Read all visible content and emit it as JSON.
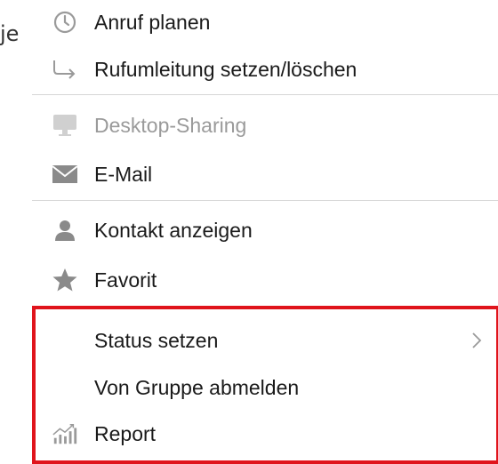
{
  "background": {
    "partial_text": "je"
  },
  "menu": {
    "items": [
      {
        "label": "Anruf planen",
        "icon": "clock-icon",
        "disabled": false
      },
      {
        "label": "Rufumleitung setzen/löschen",
        "icon": "forward-arrow-icon",
        "disabled": false
      },
      {
        "label": "Desktop-Sharing",
        "icon": "monitor-icon",
        "disabled": true
      },
      {
        "label": "E-Mail",
        "icon": "envelope-icon",
        "disabled": false
      },
      {
        "label": "Kontakt anzeigen",
        "icon": "person-icon",
        "disabled": false
      },
      {
        "label": "Favorit",
        "icon": "star-icon",
        "disabled": false
      },
      {
        "label": "Status setzen",
        "icon": "",
        "disabled": false,
        "submenu": true
      },
      {
        "label": "Von Gruppe abmelden",
        "icon": "",
        "disabled": false
      },
      {
        "label": "Report",
        "icon": "chart-icon",
        "disabled": false
      }
    ],
    "highlight_color": "#e0141c"
  }
}
